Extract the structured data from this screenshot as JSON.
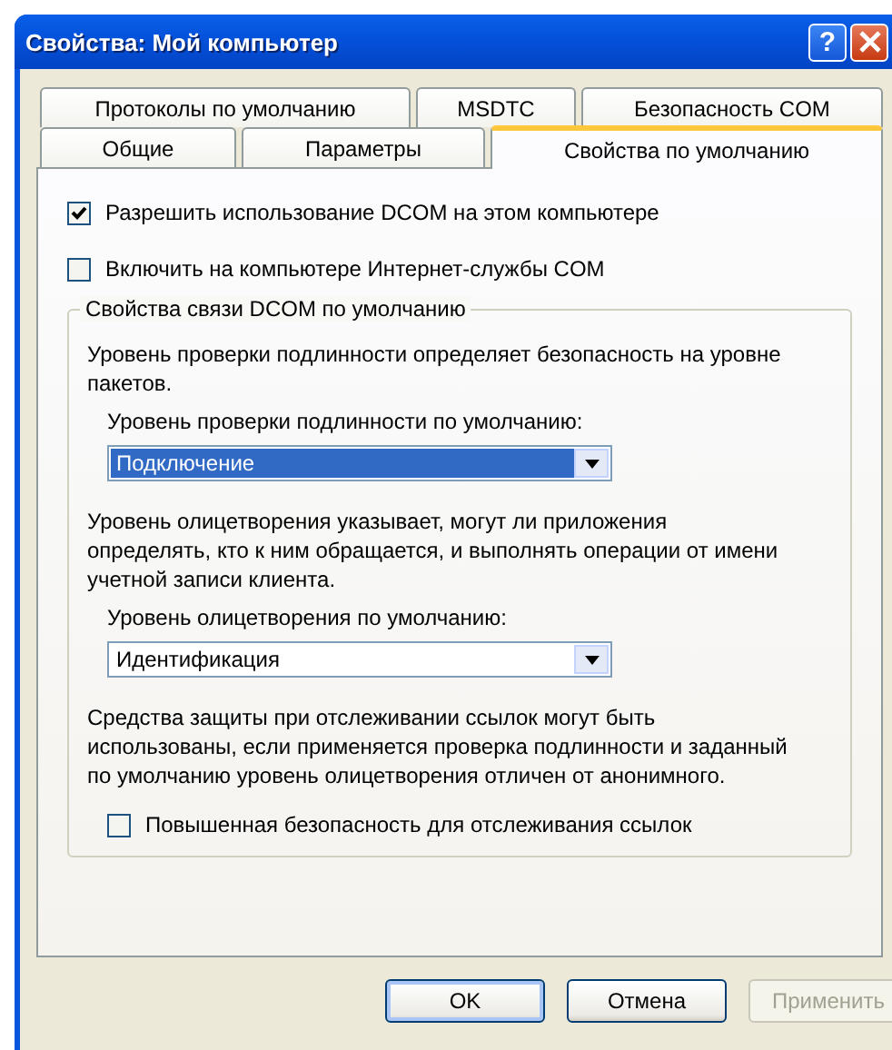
{
  "window": {
    "title": "Свойства: Мой компьютер",
    "controls": [
      {
        "kind": "help",
        "label": "?"
      },
      {
        "kind": "close"
      }
    ]
  },
  "tab_rows": [
    {
      "tabs": [
        {
          "label": "Протоколы по умолчанию",
          "selected": false
        },
        {
          "label": "MSDTC",
          "selected": false
        },
        {
          "label": "Безопасность COM",
          "selected": false
        }
      ]
    },
    {
      "tabs": [
        {
          "label": "Общие",
          "selected": false
        },
        {
          "label": "Параметры",
          "selected": false
        },
        {
          "label": "Свойства по умолчанию",
          "selected": true
        }
      ]
    }
  ],
  "checkboxes": [
    {
      "label": "Разрешить использование DCOM на этом компьютере",
      "checked": true
    },
    {
      "label": "Включить на компьютере Интернет-службы COM",
      "checked": false
    }
  ],
  "group": {
    "title": "Свойства связи DCOM по умолчанию",
    "items": [
      {
        "kind": "text",
        "text": "Уровень проверки подлинности определяет безопасность на уровне пакетов."
      },
      {
        "kind": "label",
        "text": "Уровень проверки подлинности по умолчанию:"
      },
      {
        "kind": "combo",
        "value": "Подключение",
        "focused": true
      },
      {
        "kind": "text",
        "text": "Уровень олицетворения указывает, могут ли приложения определять, кто к ним обращается, и выполнять операции от имени учетной записи клиента."
      },
      {
        "kind": "label",
        "text": "Уровень олицетворения по умолчанию:"
      },
      {
        "kind": "combo",
        "value": "Идентификация",
        "focused": false
      },
      {
        "kind": "text",
        "text": "Средства защиты при отслеживании ссылок могут быть использованы, если применяется проверка подлинности и заданный по умолчанию уровень олицетворения отличен от анонимного."
      },
      {
        "kind": "checkbox",
        "text": "Повышенная безопасность для отслеживания ссылок",
        "checked": false
      }
    ]
  },
  "buttons": [
    {
      "label": "OK",
      "default": true,
      "disabled": false
    },
    {
      "label": "Отмена",
      "default": false,
      "disabled": false
    },
    {
      "label": "Применить",
      "default": false,
      "disabled": true
    }
  ]
}
